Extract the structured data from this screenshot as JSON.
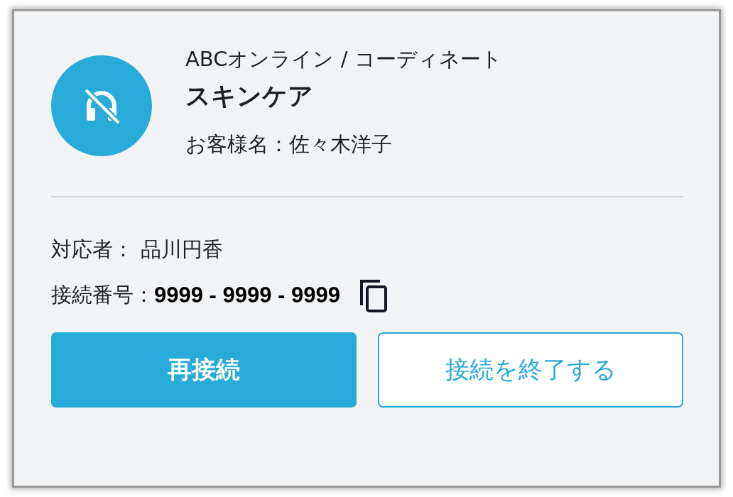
{
  "header": {
    "service": "ABCオンライン / コーディネート",
    "category": "スキンケア",
    "customer": "お客様名：佐々木洋子"
  },
  "details": [
    {
      "label": "対応者：",
      "value": "品川円香",
      "kind": "plain"
    },
    {
      "label": "接続番号：",
      "value": "9999 - 9999 - 9999",
      "kind": "copyable"
    }
  ],
  "buttons": [
    {
      "label": "再接続",
      "kind": "primary"
    },
    {
      "label": "接続を終了する",
      "kind": "outline"
    }
  ]
}
